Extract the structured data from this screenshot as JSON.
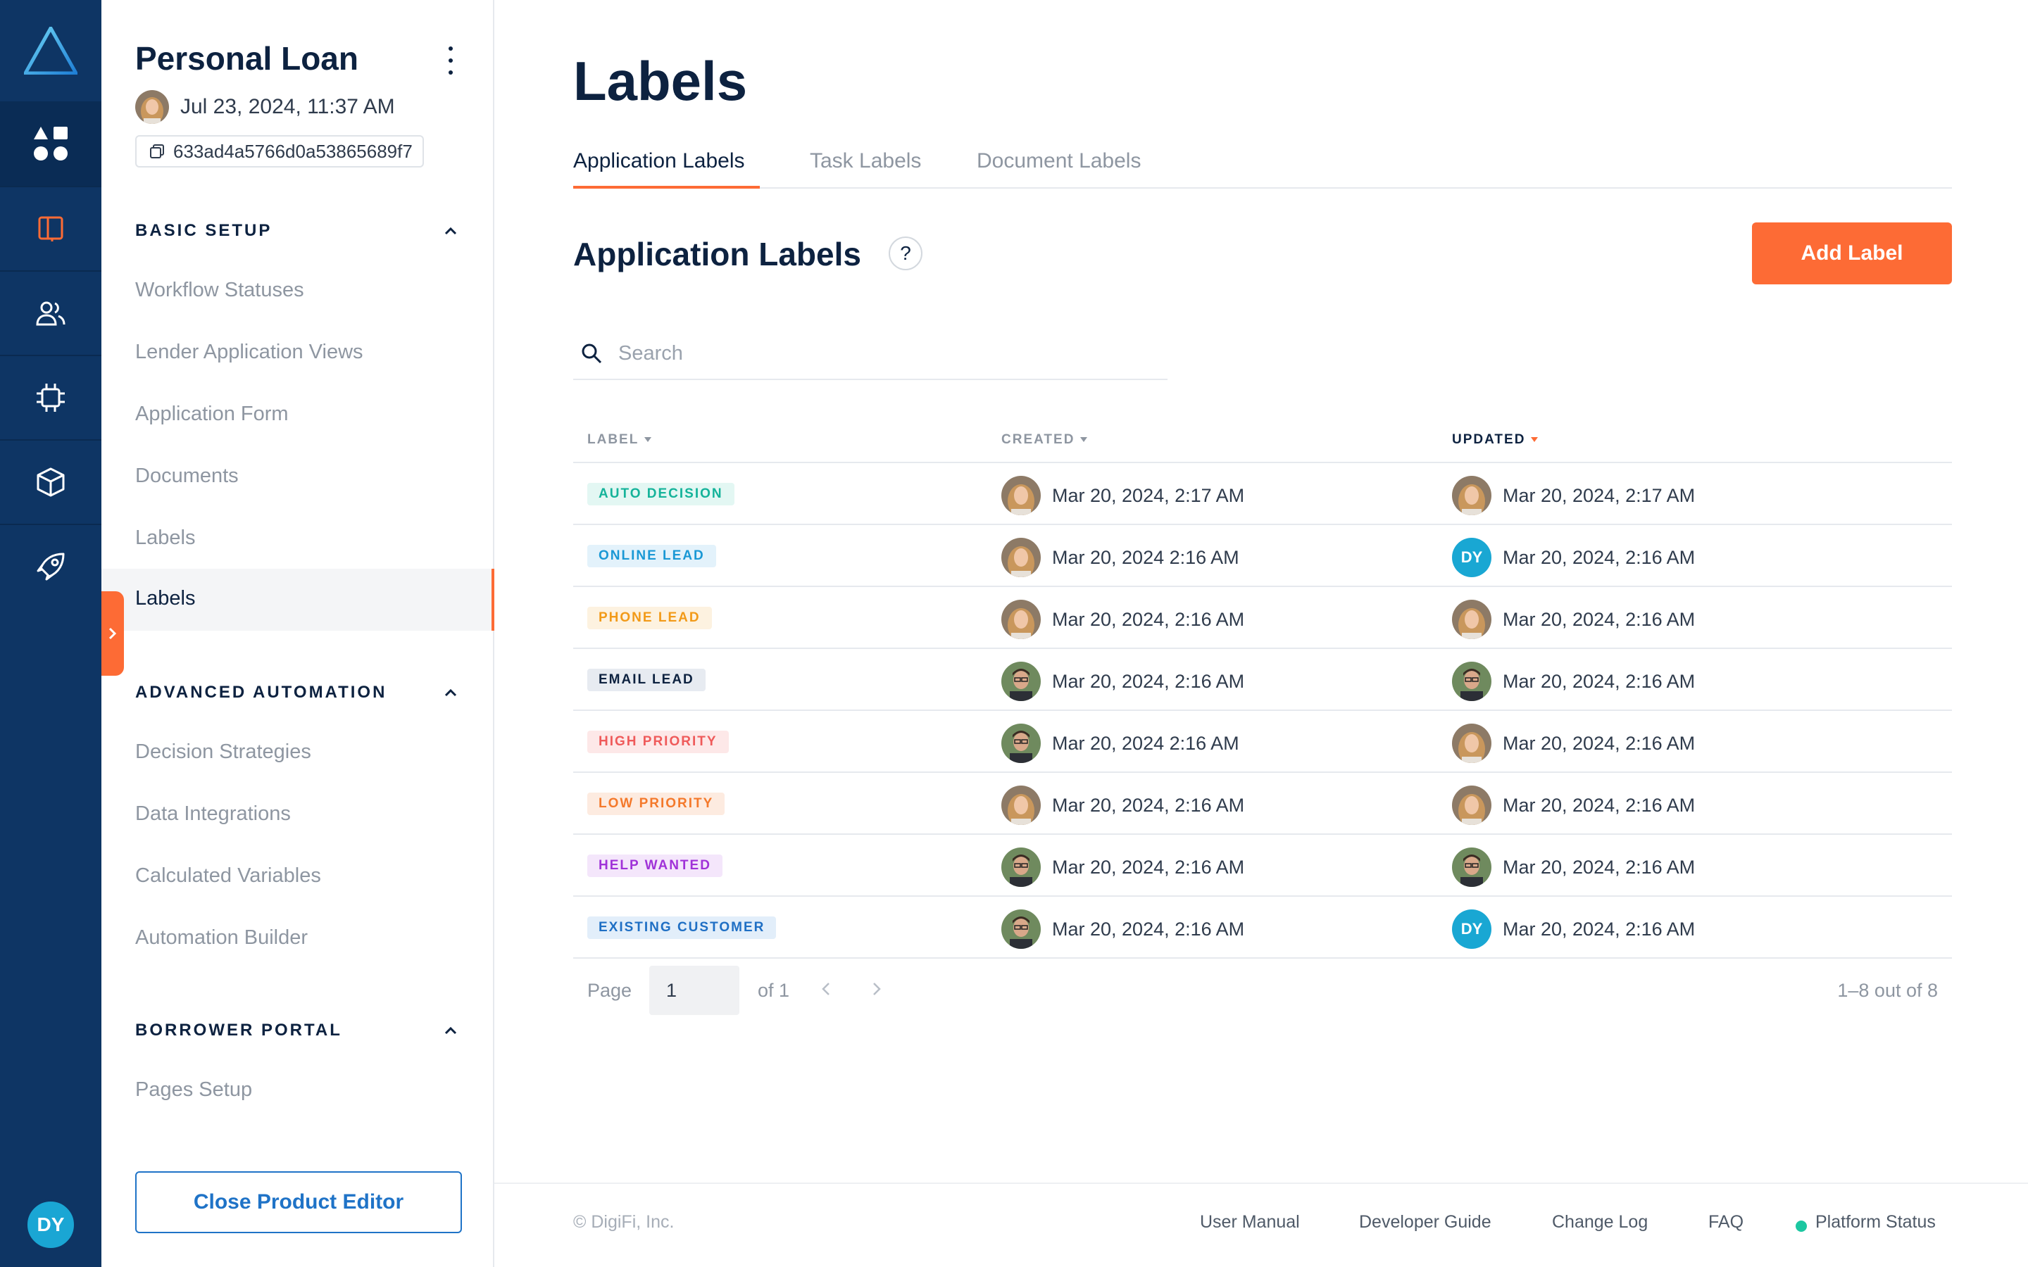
{
  "product": {
    "title": "Personal Loan",
    "timestamp": "Jul 23, 2024, 11:37 AM",
    "id": "633ad4a5766d0a53865689f7"
  },
  "nav": {
    "basic_setup": {
      "heading": "BASIC SETUP",
      "items": [
        "Workflow Statuses",
        "Lender Application Views",
        "Application Form",
        "Documents",
        "Labels"
      ],
      "active": "Labels"
    },
    "advanced_automation": {
      "heading": "ADVANCED AUTOMATION",
      "items": [
        "Decision Strategies",
        "Data Integrations",
        "Calculated Variables",
        "Automation Builder"
      ]
    },
    "borrower_portal": {
      "heading": "BORROWER PORTAL",
      "items": [
        "Pages Setup"
      ]
    },
    "close_button": "Close Product Editor"
  },
  "rail": {
    "icons": [
      "logo-icon",
      "apps-icon",
      "book-icon",
      "users-icon",
      "chip-icon",
      "cube-icon",
      "rocket-icon"
    ],
    "user_initials": "DY"
  },
  "page": {
    "title": "Labels",
    "tabs": [
      "Application Labels",
      "Task Labels",
      "Document Labels"
    ],
    "active_tab": "Application Labels",
    "section_title": "Application Labels",
    "help": "?",
    "add_button": "Add Label",
    "search_placeholder": "Search"
  },
  "table": {
    "headers": {
      "label": "LABEL",
      "created": "CREATED",
      "updated": "UPDATED"
    },
    "sorted_column": "updated",
    "rows": [
      {
        "label": "AUTO DECISION",
        "color": "#14b39a",
        "bg": "#e3f7f3",
        "created_by": "woman",
        "created": "Mar 20, 2024, 2:17 AM",
        "updated_by": "woman",
        "updated": "Mar 20, 2024, 2:17 AM"
      },
      {
        "label": "ONLINE LEAD",
        "color": "#1a98d5",
        "bg": "#e3f2fb",
        "created_by": "woman",
        "created": "Mar 20, 2024 2:16 AM",
        "updated_by": "DY",
        "updated": "Mar 20, 2024, 2:16 AM"
      },
      {
        "label": "PHONE LEAD",
        "color": "#f29a18",
        "bg": "#fdf2e0",
        "created_by": "woman",
        "created": "Mar 20, 2024, 2:16 AM",
        "updated_by": "woman",
        "updated": "Mar 20, 2024, 2:16 AM"
      },
      {
        "label": "EMAIL LEAD",
        "color": "#0d2240",
        "bg": "#e7ebf1",
        "created_by": "man",
        "created": "Mar 20, 2024, 2:16 AM",
        "updated_by": "man",
        "updated": "Mar 20, 2024, 2:16 AM"
      },
      {
        "label": "HIGH PRIORITY",
        "color": "#ef5a5a",
        "bg": "#fde8e8",
        "created_by": "man",
        "created": "Mar 20, 2024 2:16 AM",
        "updated_by": "woman",
        "updated": "Mar 20, 2024, 2:16 AM"
      },
      {
        "label": "LOW PRIORITY",
        "color": "#f4792b",
        "bg": "#fdebe0",
        "created_by": "woman",
        "created": "Mar 20, 2024, 2:16 AM",
        "updated_by": "woman",
        "updated": "Mar 20, 2024, 2:16 AM"
      },
      {
        "label": "HELP WANTED",
        "color": "#a032d8",
        "bg": "#f4e6fb",
        "created_by": "man",
        "created": "Mar 20, 2024, 2:16 AM",
        "updated_by": "man",
        "updated": "Mar 20, 2024, 2:16 AM"
      },
      {
        "label": "EXISTING CUSTOMER",
        "color": "#1f6fc4",
        "bg": "#e2eefa",
        "created_by": "man",
        "created": "Mar 20, 2024, 2:16 AM",
        "updated_by": "DY",
        "updated": "Mar 20, 2024, 2:16 AM"
      }
    ]
  },
  "pager": {
    "page_label": "Page",
    "current": "1",
    "of_label": "of 1",
    "summary": "1–8 out of 8"
  },
  "footer": {
    "copyright": "© DigiFi, Inc.",
    "links": [
      "User Manual",
      "Developer Guide",
      "Change Log",
      "FAQ"
    ],
    "status": "Platform Status"
  }
}
